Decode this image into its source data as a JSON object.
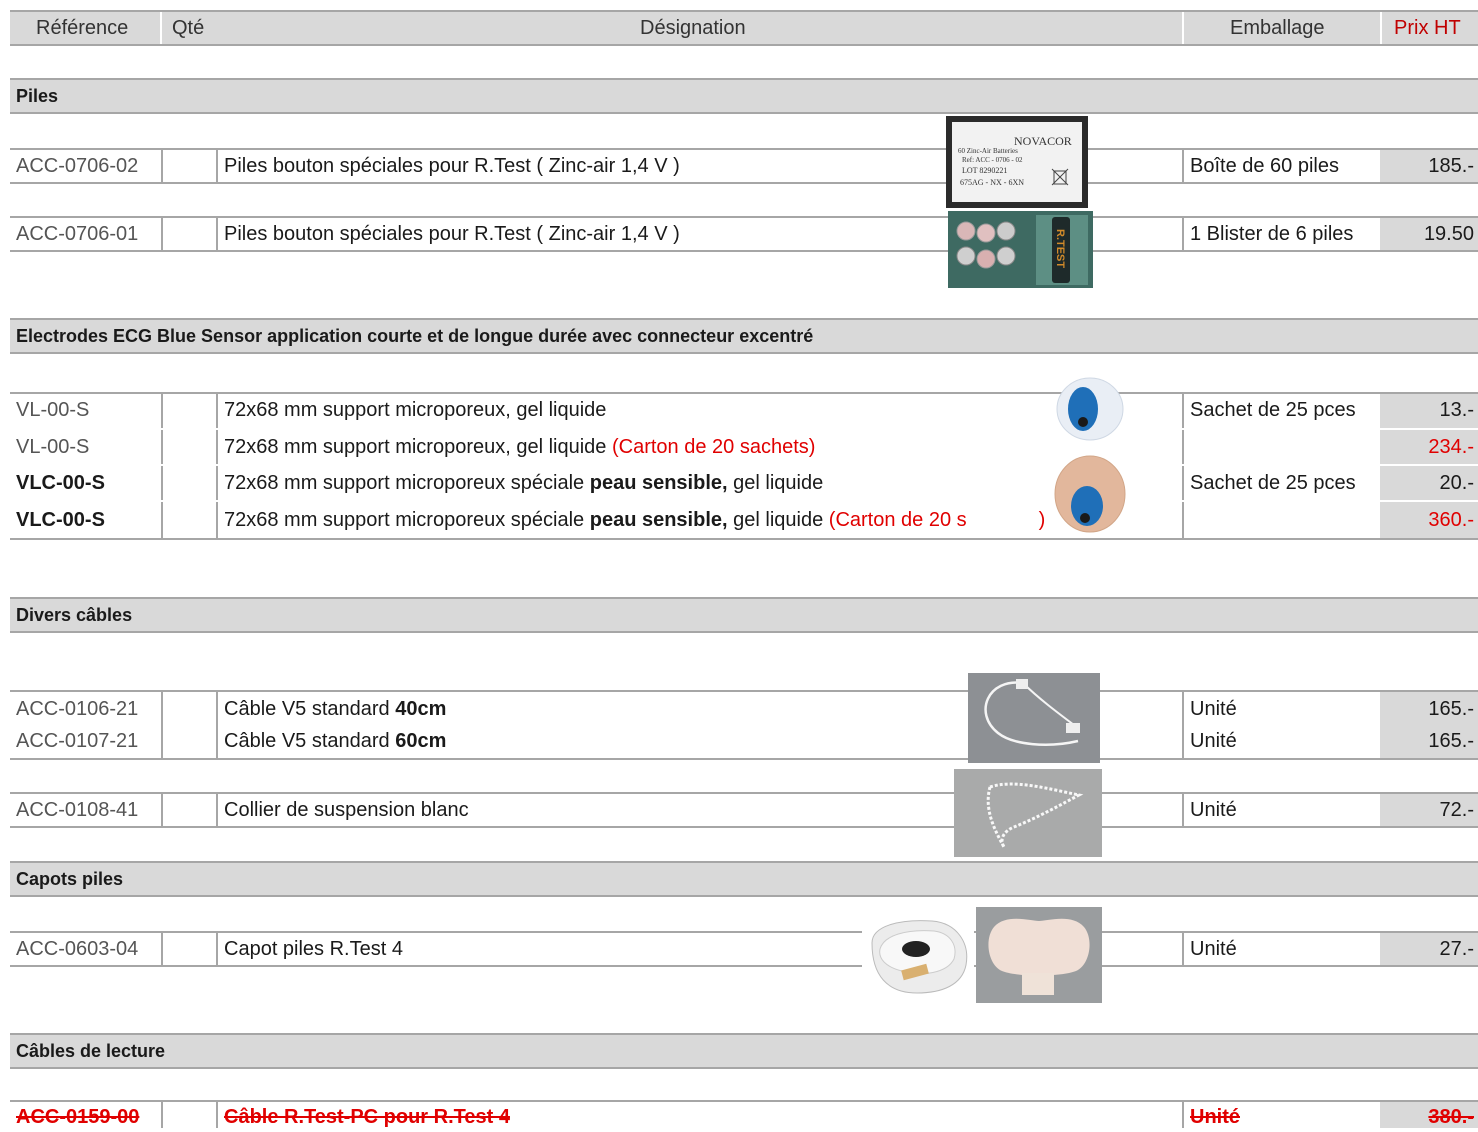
{
  "header": {
    "reference": "Référence",
    "qty": "Qté",
    "designation": "Désignation",
    "emballage": "Emballage",
    "prix": "Prix HT"
  },
  "sections": {
    "piles": "Piles",
    "electrodes": "Electrodes ECG Blue Sensor application courte et de longue durée avec connecteur excentré",
    "cables": "Divers câbles",
    "capots": "Capots piles",
    "lecture": "Câbles de lecture"
  },
  "rows": {
    "r1": {
      "ref": "ACC-0706-02",
      "designation": "Piles bouton spéciales pour R.Test ( Zinc-air 1,4 V )",
      "emballage": "Boîte de 60 piles",
      "prix": "185.-"
    },
    "r2": {
      "ref": "ACC-0706-01",
      "designation": "Piles bouton spéciales pour R.Test ( Zinc-air 1,4 V )",
      "emballage": "1 Blister de 6 piles",
      "prix": "19.50"
    },
    "r3": {
      "ref": "VL-00-S",
      "designation": "72x68 mm support microporeux, gel liquide",
      "emballage": "Sachet de 25 pces",
      "prix": "13.-"
    },
    "r4": {
      "ref": "VL-00-S",
      "designation": "72x68 mm support microporeux, gel liquide",
      "designation_red": "(Carton de 20 sachets)",
      "emballage": "",
      "prix": "234.-"
    },
    "r5": {
      "ref": "VLC-00-S",
      "designation_a": "72x68 mm support microporeux spéciale",
      "designation_bold": "peau sensible,",
      "designation_b": "gel liquide",
      "emballage": "Sachet de 25 pces",
      "prix": "20.-"
    },
    "r6": {
      "ref": "VLC-00-S",
      "designation_a": "72x68 mm support microporeux spéciale",
      "designation_bold": "peau sensible,",
      "designation_b": "gel liquide",
      "designation_red": "(Carton de 20 s",
      "designation_red_end": ")",
      "emballage": "",
      "prix": "360.-"
    },
    "r7": {
      "ref": "ACC-0106-21",
      "designation_a": "Câble V5 standard",
      "designation_bold": "40cm",
      "emballage": "Unité",
      "prix": "165.-"
    },
    "r8": {
      "ref": "ACC-0107-21",
      "designation_a": "Câble V5 standard",
      "designation_bold": "60cm",
      "emballage": "Unité",
      "prix": "165.-"
    },
    "r9": {
      "ref": "ACC-0108-41",
      "designation": "Collier de suspension blanc",
      "emballage": "Unité",
      "prix": "72.-"
    },
    "r10": {
      "ref": "ACC-0603-04",
      "designation": "Capot piles R.Test 4",
      "emballage": "Unité",
      "prix": "27.-"
    },
    "r11": {
      "ref": "ACC-0159-00",
      "designation": "Câble R.Test-PC pour R.Test 4",
      "emballage": "Unité",
      "prix": "380.-"
    }
  },
  "photos": {
    "battery_box_brand": "NOVACOR",
    "battery_box_line1": "60 Zinc-Air Batteries",
    "battery_box_line2": "Ref: ACC - 0706 - 02",
    "battery_box_line3": "LOT 8290221",
    "battery_box_line4": "675AG - NX - 6XN",
    "blister_label": "R.TEST"
  },
  "colors": {
    "header_bg": "#d9d9d9",
    "border": "#a6a6a6",
    "price_header": "#c00000",
    "red_text": "#e00000"
  }
}
